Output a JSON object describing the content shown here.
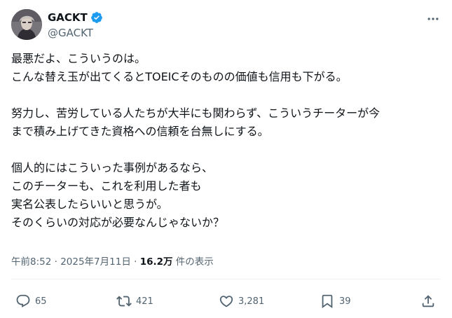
{
  "author": {
    "display_name": "GACKT",
    "handle": "@GACKT",
    "verified": true
  },
  "tweet": {
    "lines": [
      "最悪だよ、こういうのは。",
      "こんな替え玉が出てくるとTOEICそのものの価値も信用も下がる。",
      "",
      "努力し、苦労している人たちが大半にも関わらず、こういうチーターが今",
      "まで積み上げてきた資格への信頼を台無しにする。",
      "",
      "個人的にはこういった事例があるなら、",
      "このチーターも、これを利用した者も",
      "実名公表したらいいと思うが。",
      "そのくらいの対応が必要なんじゃないか？"
    ]
  },
  "meta": {
    "time": "午前8:52",
    "separator1": " · ",
    "date": "2025年7月11日",
    "separator2": " · ",
    "views_count": "16.2万",
    "views_label": " 件の表示"
  },
  "actions": {
    "replies": "65",
    "reposts": "421",
    "likes": "3,281",
    "bookmarks": "39"
  },
  "colors": {
    "text": "#0f1419",
    "secondary": "#536471",
    "verified": "#1d9bf0",
    "divider": "#eff3f4"
  }
}
